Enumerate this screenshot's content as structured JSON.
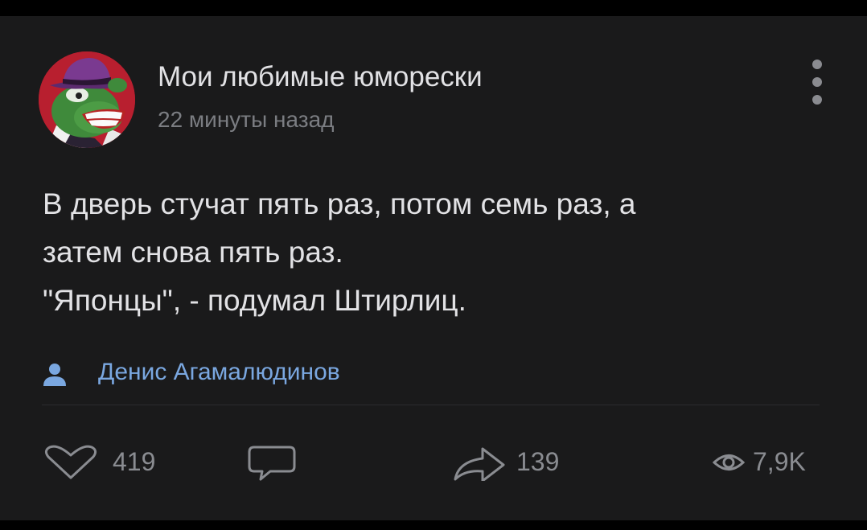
{
  "post": {
    "channel_name": "Мои любимые юморески",
    "time": "22 минуты назад",
    "text_lines": [
      "В дверь стучат пять раз, потом семь раз, а",
      "затем снова пять раз.",
      "\"Японцы\", - подумал Штирлиц."
    ],
    "author": "Денис Агамалюдинов"
  },
  "actions": {
    "likes": "419",
    "shares": "139",
    "views": "7,9K"
  },
  "icons": {
    "avatar": "green-frog-with-purple-hat-avatar",
    "menu": "vertical-dots-icon",
    "author": "person-icon",
    "like": "heart-icon",
    "comment": "comment-bubble-icon",
    "share": "share-arrow-icon",
    "views": "eye-icon"
  },
  "colors": {
    "background": "#1a1a1b",
    "text": "#e2e2e5",
    "muted": "#7b7d82",
    "link": "#7aa7e0",
    "avatar_bg": "#b81f2f"
  }
}
